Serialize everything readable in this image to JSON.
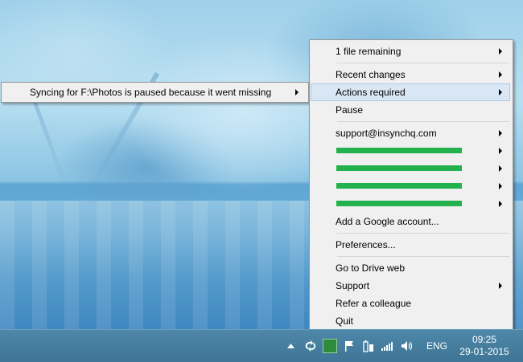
{
  "menu": {
    "items": [
      {
        "label": "1 file remaining",
        "has_submenu": true
      },
      {
        "label": "Recent changes",
        "has_submenu": true
      },
      {
        "label": "Actions required",
        "has_submenu": true,
        "highlighted": true
      },
      {
        "label": "Pause",
        "has_submenu": false
      },
      {
        "label": "support@insynchq.com",
        "has_submenu": true
      },
      {
        "label": "Add a Google account...",
        "has_submenu": false
      },
      {
        "label": "Preferences...",
        "has_submenu": false
      },
      {
        "label": "Go to Drive web",
        "has_submenu": false
      },
      {
        "label": "Support",
        "has_submenu": true
      },
      {
        "label": "Refer a colleague",
        "has_submenu": false
      },
      {
        "label": "Quit",
        "has_submenu": false
      }
    ],
    "redacted_accounts": 4
  },
  "submenu": {
    "message": "Syncing for F:\\Photos is paused because it went missing"
  },
  "taskbar": {
    "language": "ENG",
    "time": "09:25",
    "date": "29-01-2015",
    "tray_icons": [
      "show-hidden-icons",
      "sync-arrows-icon",
      "insync-icon",
      "action-center-flag-icon",
      "power-battery-icon",
      "network-signal-icon",
      "volume-icon"
    ]
  },
  "colors": {
    "redaction": "#22b14c",
    "highlight": "#d9e7f5",
    "taskbar": "#4e87a8"
  }
}
